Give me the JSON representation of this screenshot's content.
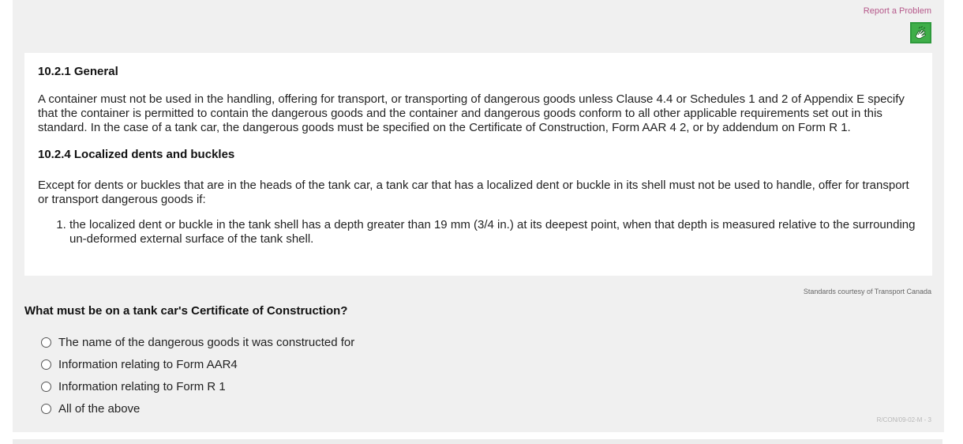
{
  "header": {
    "report_label": "Report a Problem",
    "sign_icon": "sign-language-hands-icon"
  },
  "reading": {
    "section1": {
      "title": "10.2.1 General",
      "body": "A container must not be used in the handling, offering for transport, or transporting of dangerous goods unless Clause 4.4 or Schedules 1 and 2 of Appendix E specify that the container is permitted to contain the dangerous goods and the container and dangerous goods conform to all other applicable requirements set out in this standard. In the case of a tank car, the dangerous goods must be specified on the Certificate of Construction, Form AAR 4 2, or by addendum on Form R 1."
    },
    "section2": {
      "title": "10.2.4 Localized dents and buckles",
      "body": "Except for dents or buckles that are in the heads of the tank car, a tank car that has a localized dent or buckle in its shell must not be used to handle, offer for transport or transport dangerous goods if:",
      "list": [
        "the localized dent or buckle in the tank shell has a depth greater than 19 mm (3/4 in.) at its deepest point, when that depth is measured relative to the surrounding un-deformed external surface of the tank shell."
      ]
    }
  },
  "courtesy": "Standards courtesy of Transport Canada",
  "question": {
    "text": "What must be on a tank car's Certificate of Construction?",
    "options": [
      "The name of the dangerous goods it was constructed for",
      "Information relating to Form AAR4",
      "Information relating to Form R 1",
      "All of the above"
    ]
  },
  "question_code": "R/CON/09-02-M - 3",
  "colors": {
    "panel_bg": "#f0f0f0",
    "report_link": "#b5588a",
    "sign_button": "#3fae49"
  }
}
